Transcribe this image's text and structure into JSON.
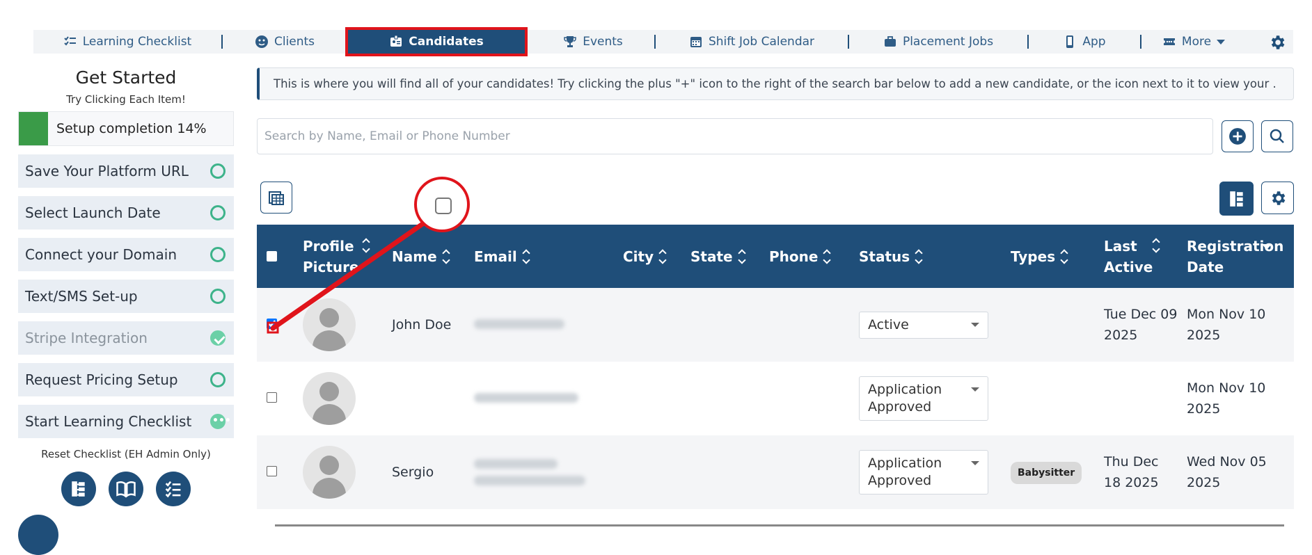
{
  "nav": {
    "items": [
      {
        "label": "Learning Checklist",
        "icon": "checklist-icon"
      },
      {
        "label": "Clients",
        "icon": "user-circle-icon"
      },
      {
        "label": "Candidates",
        "icon": "id-card-icon"
      },
      {
        "label": "Events",
        "icon": "trophy-icon"
      },
      {
        "label": "Shift Job Calendar",
        "icon": "calendar-icon"
      },
      {
        "label": "Placement Jobs",
        "icon": "briefcase-icon"
      },
      {
        "label": "App",
        "icon": "phone-icon"
      },
      {
        "label": "More",
        "icon": "ticket-icon"
      }
    ],
    "active": "Candidates"
  },
  "sidebar": {
    "title": "Get Started",
    "subtitle": "Try Clicking Each Item!",
    "progress_label": "Setup completion 14%",
    "progress_value": 0.14,
    "items": [
      {
        "label": "Save Your Platform URL",
        "state": "todo"
      },
      {
        "label": "Select Launch Date",
        "state": "todo"
      },
      {
        "label": "Connect your Domain",
        "state": "todo"
      },
      {
        "label": "Text/SMS Set-up",
        "state": "todo"
      },
      {
        "label": "Stripe Integration",
        "state": "done"
      },
      {
        "label": "Request Pricing Setup",
        "state": "todo"
      },
      {
        "label": "Start Learning Checklist",
        "state": "in-progress"
      }
    ],
    "reset_label": "Reset Checklist (EH Admin Only)"
  },
  "main": {
    "info_text": "This is where you will find all of your candidates! Try clicking the plus \"+\" icon to the right of the search bar below to add a new candidate, or the icon next to it to view your .",
    "search_placeholder": "Search by Name, Email or Phone Number"
  },
  "table": {
    "headers": {
      "profile_picture": "Profile Picture",
      "name": "Name",
      "email": "Email",
      "city": "City",
      "state": "State",
      "phone": "Phone",
      "status": "Status",
      "types": "Types",
      "last_active": "Last Active",
      "registration_date": "Registration Date"
    },
    "rows": [
      {
        "name": "John Doe",
        "status": "Active",
        "types": "",
        "last_active": "Tue Dec 09 2025",
        "registration_date": "Mon Nov 10 2025",
        "checked": true
      },
      {
        "name": "",
        "status": "Application Approved",
        "types": "",
        "last_active": "",
        "registration_date": "Mon Nov 10 2025",
        "checked": false
      },
      {
        "name": "Sergio",
        "status": "Application Approved",
        "types": "Babysitter",
        "last_active": "Thu Dec 18 2025",
        "registration_date": "Wed Nov 05 2025",
        "checked": false
      }
    ]
  },
  "colors": {
    "primary": "#1f4e79",
    "highlight": "#e0141b",
    "progress": "#3a9b48",
    "check": "#3db38a"
  }
}
